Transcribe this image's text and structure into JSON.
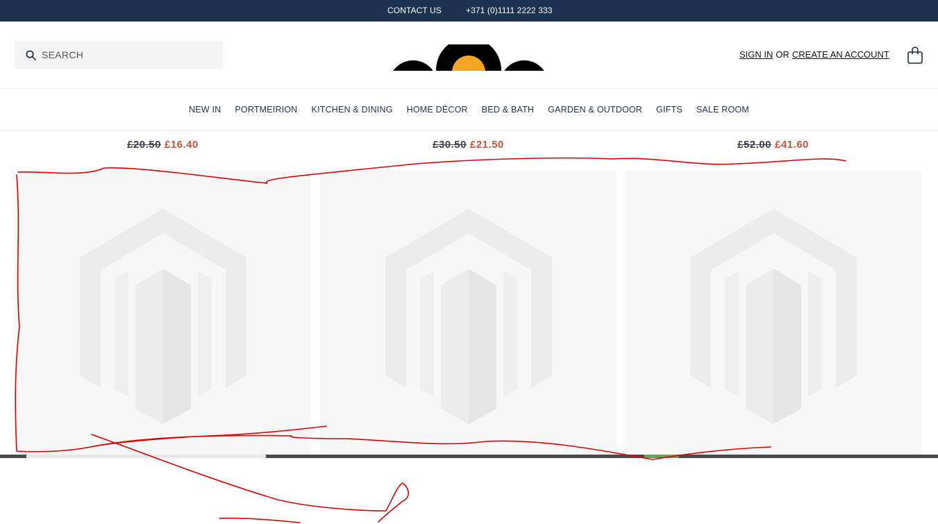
{
  "topbar": {
    "contact_label": "CONTACT US",
    "phone": "+371 (0)1111 2222 333"
  },
  "header": {
    "search_placeholder": "SEARCH",
    "sign_in": "SIGN IN",
    "or": "OR",
    "create_account": "CREATE AN ACCOUNT",
    "icons": {
      "search": "search-icon",
      "cart": "shopping-bag-icon"
    }
  },
  "nav": {
    "items": [
      "NEW IN",
      "PORTMEIRION",
      "KITCHEN & DINING",
      "HOME DÉCOR",
      "BED & BATH",
      "GARDEN & OUTDOOR",
      "GIFTS",
      "SALE ROOM"
    ]
  },
  "products": [
    {
      "old_price": "£20.50",
      "new_price": "£16.40"
    },
    {
      "old_price": "£30.50",
      "new_price": "£21.50"
    },
    {
      "old_price": "£52.00",
      "new_price": "£41.60"
    }
  ],
  "colors": {
    "topbar_bg": "#1f3150",
    "sale_price": "#c8543b",
    "annotation": "#e00000",
    "logo_accent": "#f5a623"
  }
}
